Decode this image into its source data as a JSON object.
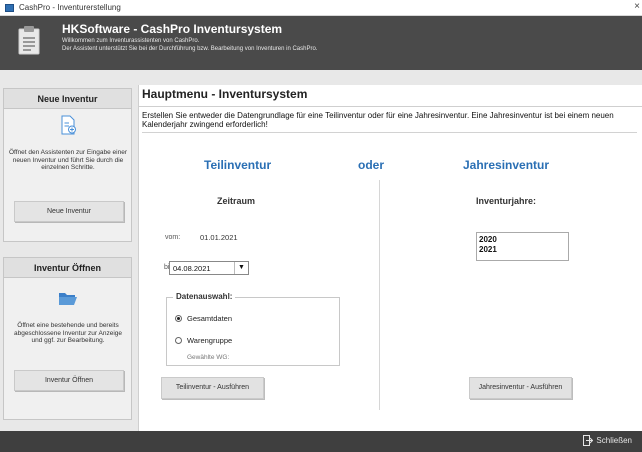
{
  "window": {
    "title": "CashPro - Inventurerstellung",
    "close_glyph": "×"
  },
  "header": {
    "title": "HKSoftware - CashPro Inventursystem",
    "subtitle1": "Willkommen zum Inventurassistenten von CashPro.",
    "subtitle2": "Der Assistent unterstützt Sie bei der Durchführung bzw. Bearbeitung von Inventuren in CashPro.",
    "icon": "clipboard-icon"
  },
  "sidebar": {
    "new_panel": {
      "title": "Neue Inventur",
      "icon": "new-document-icon",
      "description": "Öffnet den Assistenten zur Eingabe einer neuen Inventur und führt Sie durch die einzelnen Schritte.",
      "button": "Neue Inventur"
    },
    "open_panel": {
      "title": "Inventur Öffnen",
      "icon": "folder-open-icon",
      "description": "Öffnet eine bestehende und bereits abgeschlossene Inventur zur Anzeige und ggf. zur Bearbeitung.",
      "button": "Inventur Öffnen"
    }
  },
  "main": {
    "title": "Hauptmenu - Inventursystem",
    "intro": "Erstellen Sie entweder die Datengrundlage für eine Teilinventur oder für eine Jahresinventur. Eine Jahresinventur ist bei einem neuen Kalenderjahr zwingend erforderlich!",
    "teil": {
      "title": "Teilinventur",
      "zeitraum": "Zeitraum",
      "vom_label": "vom:",
      "vom_value": "01.01.2021",
      "bis_label": "bis:",
      "bis_value": "04.08.2021",
      "dropdown_glyph": "▼",
      "datenauswahl": "Datenauswahl:",
      "option1": "Gesamtdaten",
      "option2": "Warengruppe",
      "selected_option": "Gesamtdaten",
      "wg_label": "Gewählte WG:",
      "button": "Teilinventur - Ausführen"
    },
    "oder": "oder",
    "jahres": {
      "title": "Jahresinventur",
      "years_label": "Inventurjahre:",
      "years": [
        "2020",
        "2021"
      ],
      "button": "Jahresinventur - Ausführen"
    },
    "colors": {
      "accent": "#2a6fb4",
      "header_bg": "#4a4a4a",
      "footer_bg": "#3f3f3f"
    }
  },
  "footer": {
    "exit_label": "Schließen",
    "exit_icon": "exit-icon"
  }
}
